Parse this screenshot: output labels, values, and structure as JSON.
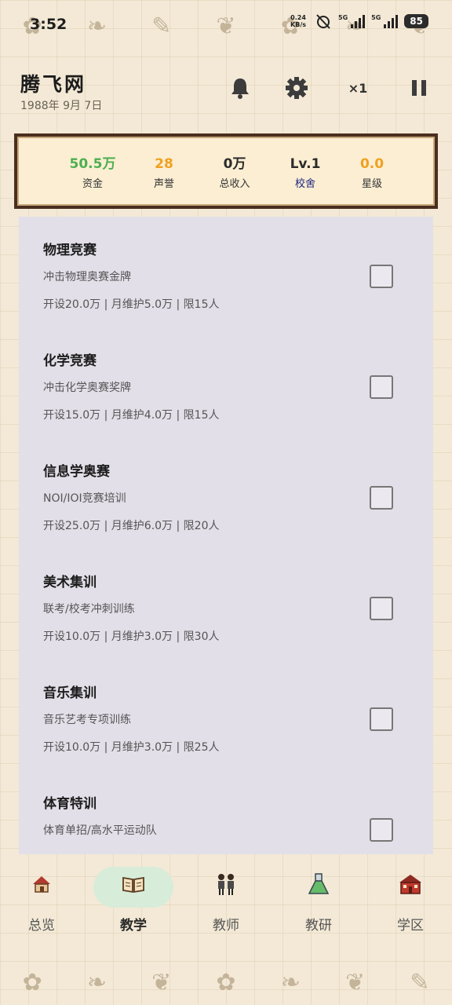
{
  "status_bar": {
    "time": "3:52",
    "net_speed": "0.24",
    "net_unit": "KB/s",
    "sig1_label": "5G",
    "sig2_label": "5G",
    "battery": "85"
  },
  "header": {
    "school_name": "腾飞网",
    "date": "1988年 9月 7日",
    "speed": "×1"
  },
  "stats": [
    {
      "value": "50.5万",
      "label": "资金",
      "value_color": "#4caf50",
      "label_color": "#333333"
    },
    {
      "value": "28",
      "label": "声誉",
      "value_color": "#f0a020",
      "label_color": "#333333"
    },
    {
      "value": "0万",
      "label": "总收入",
      "value_color": "#2b2b2b",
      "label_color": "#333333"
    },
    {
      "value": "Lv.1",
      "label": "校舍",
      "value_color": "#2b2b2b",
      "label_color": "#1a237e"
    },
    {
      "value": "0.0",
      "label": "星级",
      "value_color": "#f0a020",
      "label_color": "#333333"
    }
  ],
  "courses": [
    {
      "name": "物理竞赛",
      "desc": "冲击物理奥赛金牌",
      "cost": "开设20.0万 | 月维护5.0万 | 限15人",
      "checked": false
    },
    {
      "name": "化学竞赛",
      "desc": "冲击化学奥赛奖牌",
      "cost": "开设15.0万 | 月维护4.0万 | 限15人",
      "checked": false
    },
    {
      "name": "信息学奥赛",
      "desc": "NOI/IOI竞赛培训",
      "cost": "开设25.0万 | 月维护6.0万 | 限20人",
      "checked": false
    },
    {
      "name": "美术集训",
      "desc": "联考/校考冲刺训练",
      "cost": "开设10.0万 | 月维护3.0万 | 限30人",
      "checked": false
    },
    {
      "name": "音乐集训",
      "desc": "音乐艺考专项训练",
      "cost": "开设10.0万 | 月维护3.0万 | 限25人",
      "checked": false
    },
    {
      "name": "体育特训",
      "desc": "体育单招/高水平运动队",
      "cost": "",
      "checked": false
    }
  ],
  "nav": [
    {
      "label": "总览",
      "icon": "house-icon"
    },
    {
      "label": "教学",
      "icon": "book-icon"
    },
    {
      "label": "教师",
      "icon": "teachers-icon"
    },
    {
      "label": "教研",
      "icon": "flask-icon"
    },
    {
      "label": "学区",
      "icon": "school-building-icon"
    }
  ],
  "active_nav": "教学"
}
